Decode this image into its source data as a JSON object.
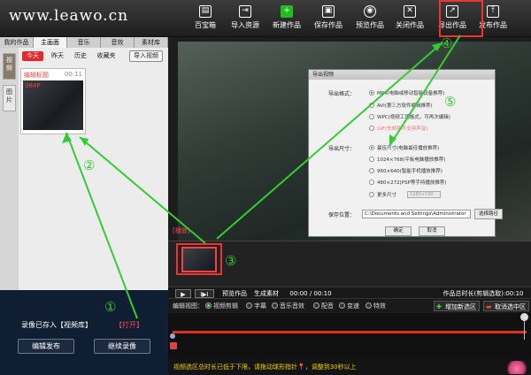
{
  "header": {
    "logo": "www.leawo.cn",
    "toolbar": [
      {
        "label": "百宝箱",
        "icon": "toolbox-icon",
        "glyph": "▤"
      },
      {
        "label": "导入资源",
        "icon": "import-icon",
        "glyph": "⇥"
      },
      {
        "label": "新建作品",
        "icon": "new-project-icon",
        "glyph": "+"
      },
      {
        "label": "保存作品",
        "icon": "save-icon",
        "glyph": "▣"
      },
      {
        "label": "预览作品",
        "icon": "eye-icon",
        "glyph": "◉"
      },
      {
        "label": "关闭作品",
        "icon": "close-project-icon",
        "glyph": "✕"
      },
      {
        "label": "导出作品",
        "icon": "export-icon",
        "glyph": "↗"
      },
      {
        "label": "发布作品",
        "icon": "publish-icon",
        "glyph": "⤒"
      }
    ]
  },
  "left": {
    "top_tabs": [
      "我的作品",
      "主画面",
      "音乐",
      "音效",
      "素材库"
    ],
    "side_tabs": [
      "视频",
      "图片"
    ],
    "sub_tabs": [
      "今天",
      "昨天",
      "历史",
      "收藏夹"
    ],
    "import_label": "导入视频",
    "clip": {
      "title": "编辑标题",
      "duration": "00:11",
      "resolution": "384P"
    },
    "saved_text": "录像已存入【视频库】",
    "open_link": "【打开】",
    "edit_publish": "编辑发布",
    "continue_record": "继续录像"
  },
  "preview": {
    "label": "[播放]"
  },
  "dialog": {
    "title": "导出视频",
    "format_label": "导出格式：",
    "formats": [
      "MP4(电脑或移动智能设备推荐)",
      "AVI(第三方软件编辑推荐)",
      "WPC(视频工场格式，可再次编辑)",
      "GIF(失帧和不支持声音)"
    ],
    "size_label": "导出尺寸：",
    "sizes": [
      "最佳尺寸(电脑最佳播放推荐)",
      "1024×768(平板电脑播放推荐)",
      "960×640(智能手机播放推荐)",
      "480×272(PSP等手持播放推荐)",
      "更多尺寸"
    ],
    "custom_size": "1280×720",
    "save_label": "保存位置：",
    "save_path": "C:\\Documents and Settings\\Administrator",
    "path_button": "选择路径",
    "ok": "确定",
    "cancel": "取消"
  },
  "controls": {
    "play": "▶",
    "step": "I▶I",
    "preview_work": "预览作品",
    "generate": "生成素材",
    "time": "00:00 / 00:10",
    "duration_label": "作品总时长(剪辑选取):00:10"
  },
  "edit": {
    "label": "编辑视图：",
    "options": [
      "视频剪辑",
      "字幕",
      "音乐音效",
      "配音",
      "变速",
      "特效"
    ],
    "add_section": "增加新选区",
    "cancel_section": "取消选中区"
  },
  "status": {
    "text": "视频选区总时长已低于下限，请拖动球形指针📍，调整到30秒以上"
  },
  "annotations": [
    "①",
    "②",
    "③",
    "④",
    "⑤"
  ],
  "colors": {
    "accent": "#e7262b",
    "annotation": "#33cc33",
    "status": "#f2d000"
  }
}
